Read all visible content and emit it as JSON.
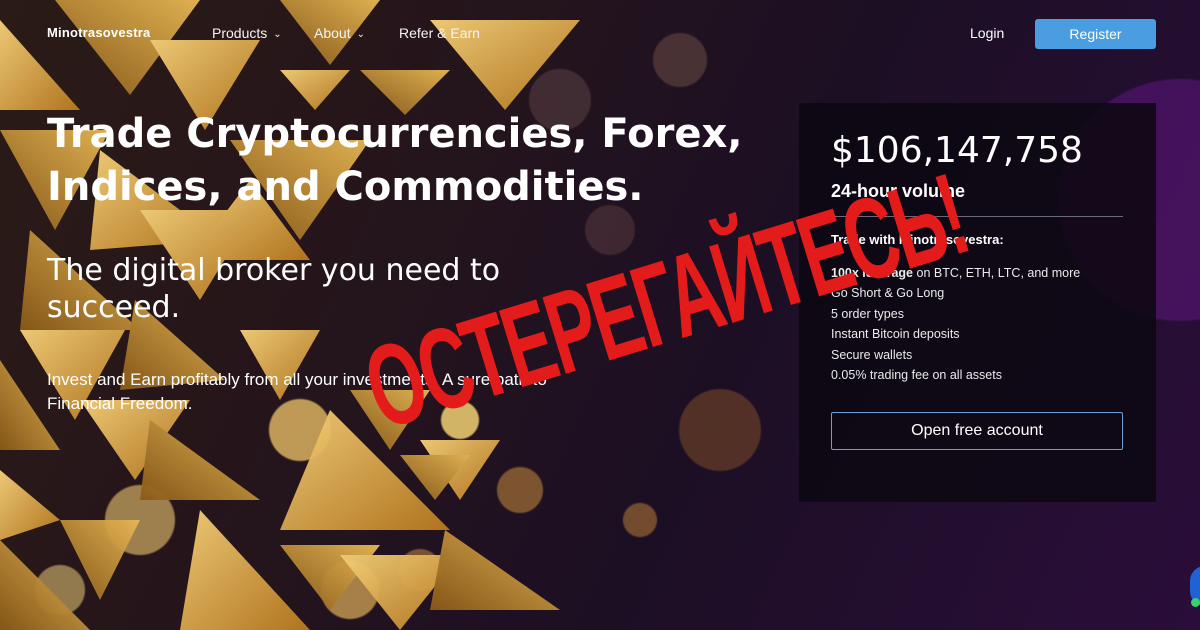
{
  "nav": {
    "brand": "Minotrasovestra",
    "products": "Products",
    "about": "About",
    "refer": "Refer & Earn",
    "login": "Login",
    "register": "Register"
  },
  "hero": {
    "title": "Trade Cryptocurrencies, Forex, Indices, and Commodities.",
    "subtitle": "The digital broker you need to succeed.",
    "description": "Invest and Earn profitably from all your investments. A sure path to Financial Freedom."
  },
  "panel": {
    "volume": "$106,147,758",
    "volume_label": "24-hour volume",
    "features_title": "Trade with Minotrasovestra:",
    "features": [
      {
        "bold": "100x leverage",
        "text": " on BTC, ETH, LTC, and more"
      },
      {
        "bold": "",
        "text": "Go Short & Go Long"
      },
      {
        "bold": "",
        "text": "5 order types"
      },
      {
        "bold": "",
        "text": "Instant Bitcoin deposits"
      },
      {
        "bold": "",
        "text": "Secure wallets"
      },
      {
        "bold": "",
        "text": "0.05% trading fee on all assets"
      }
    ],
    "cta": "Open free account"
  },
  "overlay": {
    "warning": "ОСТЕРЕГАЙТЕСЬ!",
    "color": "#e41b1b"
  },
  "colors": {
    "register_bg": "#4a9de0",
    "cta_border": "#6f9ed0"
  }
}
